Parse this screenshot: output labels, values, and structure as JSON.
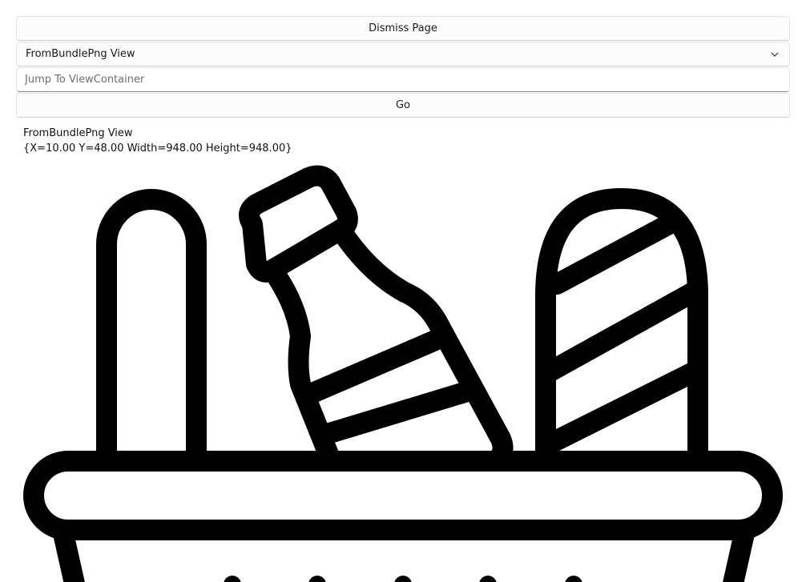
{
  "dismiss_label": "Dismiss Page",
  "view_picker": {
    "selected": "FromBundlePng View"
  },
  "jump_input": {
    "value": "",
    "placeholder": "Jump To ViewContainer"
  },
  "go_label": "Go",
  "view_info": {
    "title": "FromBundlePng View",
    "bounds": "{X=10.00 Y=48.00 Width=948.00 Height=948.00}"
  },
  "image": {
    "icon": "basket-with-bread-bottle-baguette-icon",
    "stroke_color": "#000000"
  },
  "colors": {
    "background": "#ffffff",
    "control_bg": "#fbfbfb",
    "border": "#e5e5e5",
    "text": "#1a1a1a"
  }
}
